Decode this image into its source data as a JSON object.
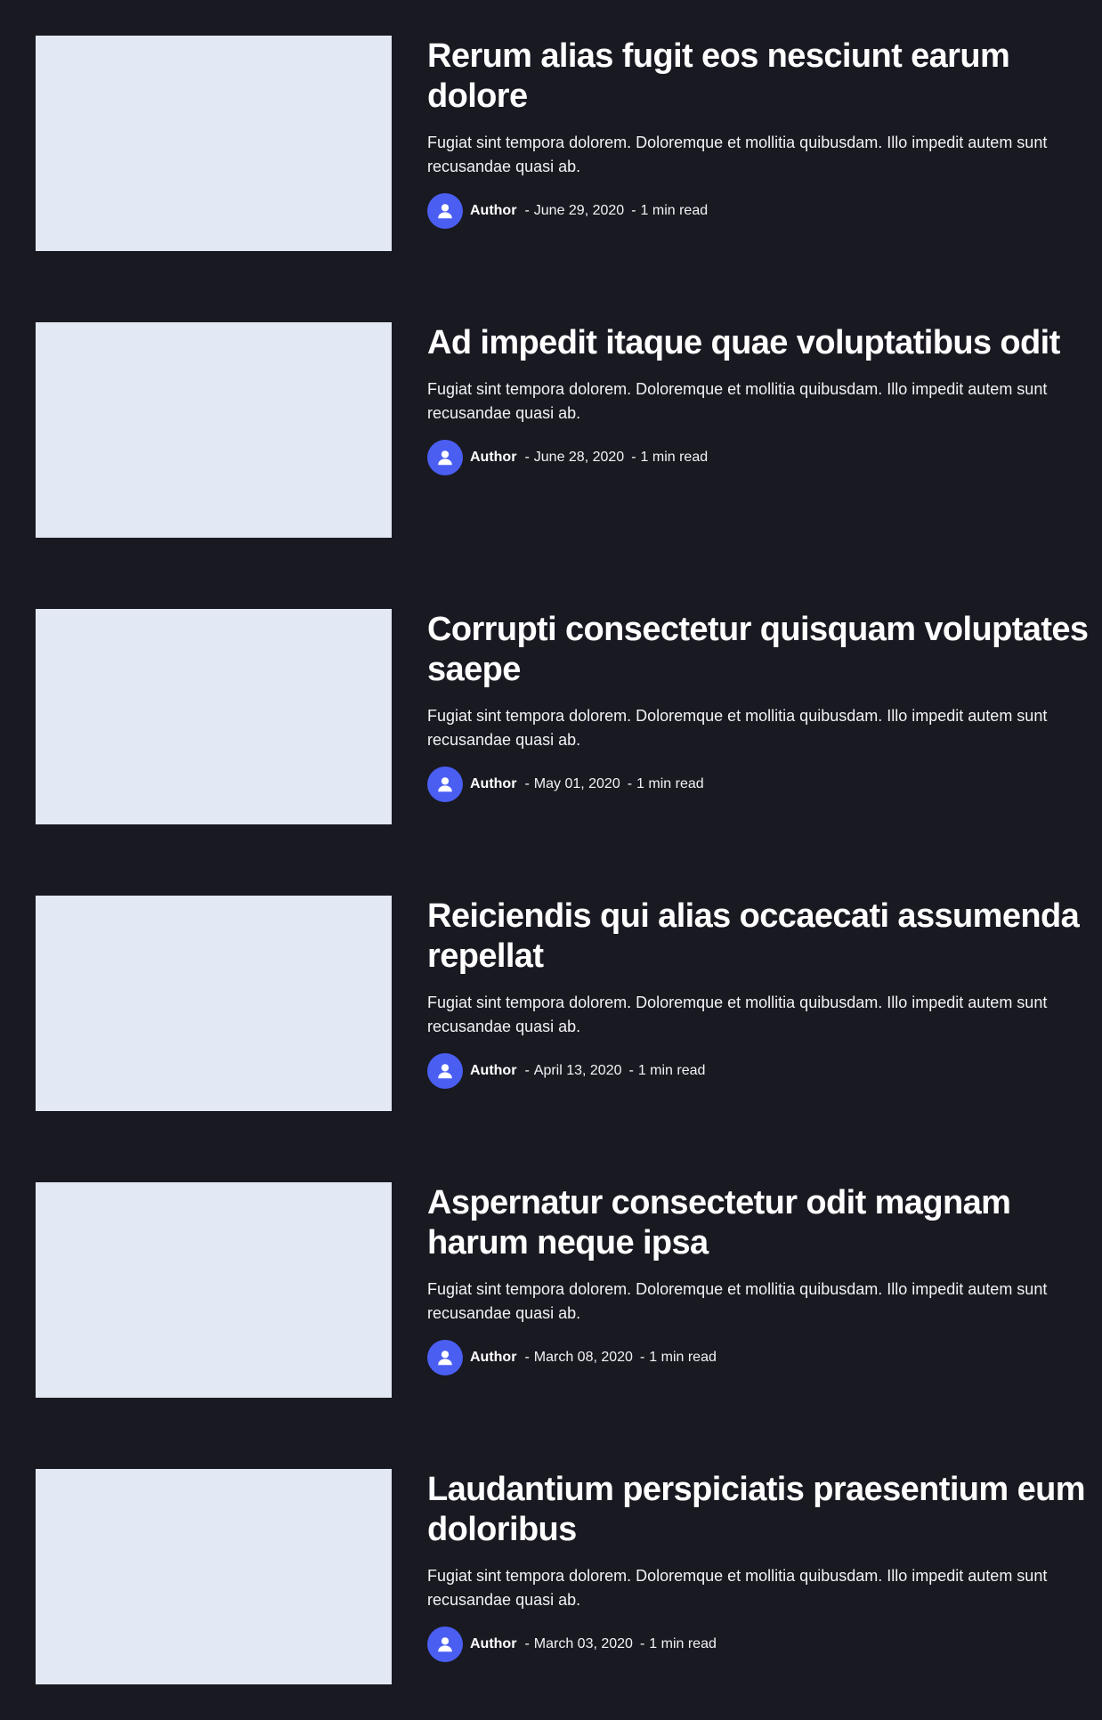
{
  "colors": {
    "background": "#191922",
    "thumbnail": "#e2e8f4",
    "avatar": "#4a5ff2",
    "text": "#ffffff"
  },
  "posts": [
    {
      "title": "Rerum alias fugit eos nesciunt earum dolore",
      "excerpt": "Fugiat sint tempora dolorem. Doloremque et mollitia quibusdam. Illo impedit autem sunt recusandae quasi ab.",
      "author": "Author",
      "date": "June 29, 2020",
      "read_time": "1 min read",
      "separator": "-",
      "avatar_icon": "user-icon"
    },
    {
      "title": "Ad impedit itaque quae voluptatibus odit",
      "excerpt": "Fugiat sint tempora dolorem. Doloremque et mollitia quibusdam. Illo impedit autem sunt recusandae quasi ab.",
      "author": "Author",
      "date": "June 28, 2020",
      "read_time": "1 min read",
      "separator": "-",
      "avatar_icon": "user-icon"
    },
    {
      "title": "Corrupti consectetur quisquam voluptates saepe",
      "excerpt": "Fugiat sint tempora dolorem. Doloremque et mollitia quibusdam. Illo impedit autem sunt recusandae quasi ab.",
      "author": "Author",
      "date": "May 01, 2020",
      "read_time": "1 min read",
      "separator": "-",
      "avatar_icon": "user-icon"
    },
    {
      "title": "Reiciendis qui alias occaecati assumenda repellat",
      "excerpt": "Fugiat sint tempora dolorem. Doloremque et mollitia quibusdam. Illo impedit autem sunt recusandae quasi ab.",
      "author": "Author",
      "date": "April 13, 2020",
      "read_time": "1 min read",
      "separator": "-",
      "avatar_icon": "user-icon"
    },
    {
      "title": "Aspernatur consectetur odit magnam harum neque ipsa",
      "excerpt": "Fugiat sint tempora dolorem. Doloremque et mollitia quibusdam. Illo impedit autem sunt recusandae quasi ab.",
      "author": "Author",
      "date": "March 08, 2020",
      "read_time": "1 min read",
      "separator": "-",
      "avatar_icon": "user-icon"
    },
    {
      "title": "Laudantium perspiciatis praesentium eum doloribus",
      "excerpt": "Fugiat sint tempora dolorem. Doloremque et mollitia quibusdam. Illo impedit autem sunt recusandae quasi ab.",
      "author": "Author",
      "date": "March 03, 2020",
      "read_time": "1 min read",
      "separator": "-",
      "avatar_icon": "user-icon"
    }
  ]
}
